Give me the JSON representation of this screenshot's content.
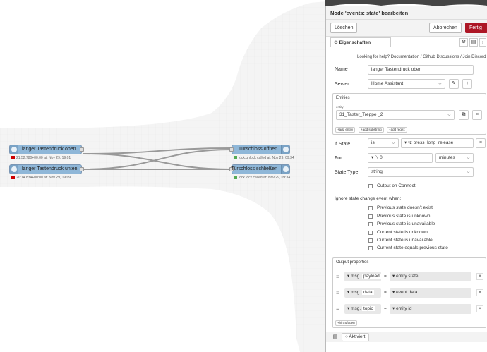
{
  "flow": {
    "nodes": [
      {
        "label": "langer Tastendruck oben",
        "status": "21:52.780+00:00 at: Nov 29, 19:01",
        "status_color": "#cc0000"
      },
      {
        "label": "langer Tastendruck unten",
        "status": "20:14.834+00:00 at: Nov 29, 19:09",
        "status_color": "#cc0000"
      },
      {
        "label": "Türschloss öffnen",
        "status": "lock.unlock called at: Nov 29, 09:34",
        "status_color": "#55aa55"
      },
      {
        "label": "Türschloss schließen",
        "status": "lock.lock called at: Nov 29, 09:34",
        "status_color": "#55aa55"
      }
    ]
  },
  "panel": {
    "title": "Node 'events: state' bearbeiten",
    "delete_label": "Löschen",
    "cancel_label": "Abbrechen",
    "done_label": "Fertig",
    "tab_label": "Eigenschaften",
    "help_prefix": "Looking for help?",
    "help_links": [
      "Documentation",
      "Github Discussions",
      "Join Discord"
    ],
    "name_label": "Name",
    "name_value": "langer Tastendruck oben",
    "server_label": "Server",
    "server_value": "Home Assistant",
    "entities_label": "Entities",
    "entity_sublabel": "entity",
    "entity_value": "31_Taster_Treppe _2",
    "add_buttons": [
      "add entity",
      "add substring",
      "add regex"
    ],
    "ifstate_label": "If State",
    "ifstate_op": "is",
    "ifstate_value": "press_long_release",
    "for_label": "For",
    "for_value": "0",
    "for_unit": "minutes",
    "statetype_label": "State Type",
    "statetype_value": "string",
    "output_connect_label": "Output on Connect",
    "ignore_label": "Ignore state change event when:",
    "ignore_options": [
      "Previous state doesn't exist",
      "Previous state is unknown",
      "Previous state is unavailable",
      "Current state is unknown",
      "Current state is unavailable",
      "Current state equals previous state"
    ],
    "output_props_label": "Output properties",
    "output_props": [
      {
        "prefix": "msg.",
        "prop": "payload",
        "value": "entity state"
      },
      {
        "prefix": "msg.",
        "prop": "data",
        "value": "event data"
      },
      {
        "prefix": "msg.",
        "prop": "topic",
        "value": "entity id"
      }
    ],
    "add_prop_label": "hinzufügen",
    "footer_status": "Aktiviert"
  }
}
